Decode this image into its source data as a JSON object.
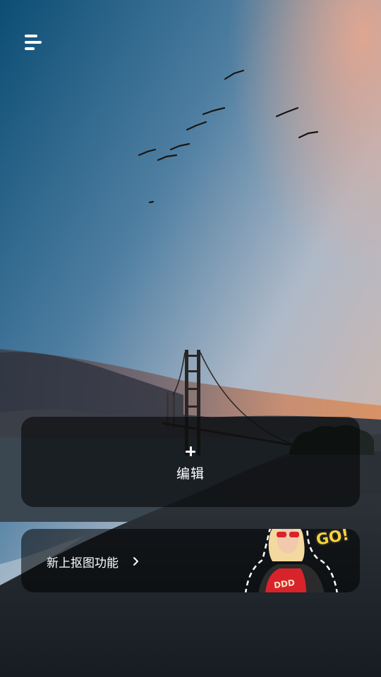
{
  "menu": {
    "icon": "menu-lines-icon"
  },
  "edit": {
    "icon": "plus-icon",
    "label": "编辑"
  },
  "cutout": {
    "label": "新上抠图功能",
    "arrow_icon": "chevron-right-icon",
    "sticker_text": "GO!"
  },
  "colors": {
    "card_bg": "rgba(0,0,0,0.55)",
    "text": "#ffffff",
    "sticker_yellow": "#f7d23a",
    "shirt_red": "#d9232b"
  }
}
